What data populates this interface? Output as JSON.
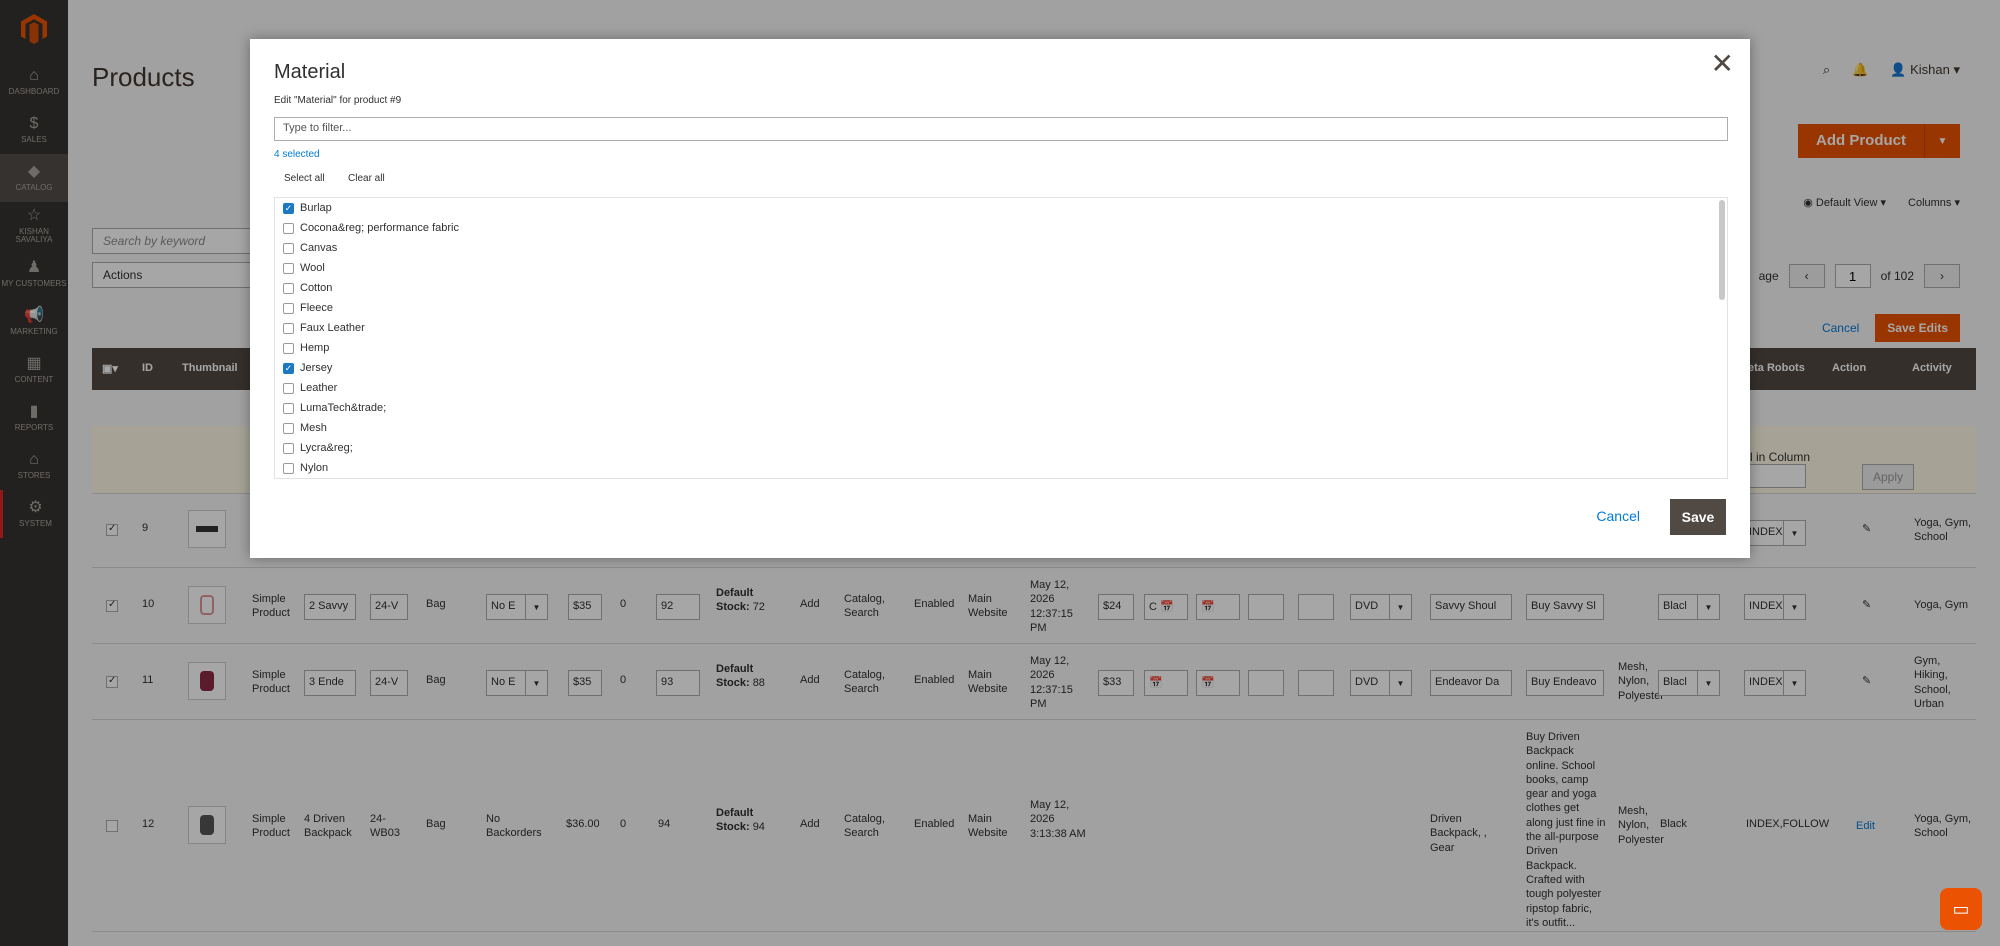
{
  "sidebar": {
    "items": [
      {
        "label": "DASHBOARD",
        "icon": "dashboard-icon",
        "glyph": "⌂"
      },
      {
        "label": "SALES",
        "icon": "dollar-icon",
        "glyph": "$"
      },
      {
        "label": "CATALOG",
        "icon": "cube-icon",
        "glyph": "◆"
      },
      {
        "label": "KISHAN SAVALIYA",
        "icon": "star-icon",
        "glyph": "☆"
      },
      {
        "label": "MY CUSTOMERS",
        "icon": "person-icon",
        "glyph": "♟"
      },
      {
        "label": "MARKETING",
        "icon": "megaphone-icon",
        "glyph": "📢"
      },
      {
        "label": "CONTENT",
        "icon": "content-icon",
        "glyph": "▦"
      },
      {
        "label": "REPORTS",
        "icon": "bar-chart-icon",
        "glyph": "▮"
      },
      {
        "label": "STORES",
        "icon": "store-icon",
        "glyph": "⌂"
      },
      {
        "label": "SYSTEM",
        "icon": "gear-icon",
        "glyph": "⚙"
      }
    ]
  },
  "page": {
    "title": "Products",
    "user": "Kishan",
    "add_product": "Add Product",
    "search_placeholder": "Search by keyword",
    "actions": "Actions",
    "default_view": "Default View",
    "columns": "Columns",
    "page_label": "age",
    "page_num": "1",
    "page_total": "of 102",
    "cancel": "Cancel",
    "save_edits": "Save Edits"
  },
  "grid": {
    "headers": {
      "id": "ID",
      "thumbnail": "Thumbnail",
      "meta_robots": "eta Robots",
      "action": "Action",
      "activity": "Activity"
    },
    "filter": {
      "in_column": "l in Column",
      "apply": "Apply"
    },
    "rows": [
      {
        "checked": true,
        "id": "9",
        "activity": "Yoga, Gym, School",
        "robots": "INDEX"
      },
      {
        "checked": true,
        "id": "10",
        "type": "Simple Product",
        "name": "2 Savvy",
        "sku": "24-V",
        "set": "Bag",
        "backorders": "No E",
        "price": "$35",
        "qty_zero": "0",
        "qty": "92",
        "stock_label": "Default Stock:",
        "stock": "72",
        "add": "Add",
        "visibility": "Catalog, Search",
        "status": "Enabled",
        "website": "Main Website",
        "date": "May 12, 2026 12:37:15 PM",
        "special": "$24",
        "c1": "C",
        "format": "DVD",
        "meta_title": "Savvy Shoul",
        "meta_desc": "Buy Savvy Sl",
        "color": "Blacl",
        "robots": "INDEX",
        "activity": "Yoga, Gym"
      },
      {
        "checked": true,
        "id": "11",
        "type": "Simple Product",
        "name": "3 Ende",
        "sku": "24-V",
        "set": "Bag",
        "backorders": "No E",
        "price": "$35",
        "qty_zero": "0",
        "qty": "93",
        "stock_label": "Default Stock:",
        "stock": "88",
        "add": "Add",
        "visibility": "Catalog, Search",
        "status": "Enabled",
        "website": "Main Website",
        "date": "May 12, 2026 12:37:15 PM",
        "special": "$33",
        "format": "DVD",
        "meta_title": "Endeavor Da",
        "meta_desc": "Buy Endeavo",
        "material": "Mesh, Nylon, Polyester",
        "color": "Blacl",
        "robots": "INDEX",
        "activity": "Gym, Hiking, School, Urban"
      },
      {
        "checked": false,
        "id": "12",
        "type": "Simple Product",
        "name": "4 Driven Backpack",
        "sku": "24-WB03",
        "set": "Bag",
        "backorders": "No Backorders",
        "price": "$36.00",
        "qty_zero": "0",
        "qty": "94",
        "stock_label": "Default Stock:",
        "stock": "94",
        "add": "Add",
        "visibility": "Catalog, Search",
        "status": "Enabled",
        "website": "Main Website",
        "date": "May 12, 2026 3:13:38 AM",
        "meta_title": "Driven Backpack, , Gear",
        "description": "Buy Driven Backpack online. School books, camp gear and yoga clothes get along just fine in the all-purpose Driven Backpack. Crafted with tough polyester ripstop fabric, it's outfit...",
        "material": "Mesh, Nylon, Polyester",
        "color": "Black",
        "robots": "INDEX,FOLLOW",
        "edit": "Edit",
        "activity": "Yoga, Gym, School"
      }
    ]
  },
  "modal": {
    "title": "Material",
    "subtitle": "Edit \"Material\" for product #9",
    "filter_placeholder": "Type to filter...",
    "selected_count": "4 selected",
    "select_all": "Select all",
    "clear_all": "Clear all",
    "options": [
      {
        "label": "Burlap",
        "checked": true
      },
      {
        "label": "Cocona&reg; performance fabric",
        "checked": false
      },
      {
        "label": "Canvas",
        "checked": false
      },
      {
        "label": "Wool",
        "checked": false
      },
      {
        "label": "Cotton",
        "checked": false
      },
      {
        "label": "Fleece",
        "checked": false
      },
      {
        "label": "Faux Leather",
        "checked": false
      },
      {
        "label": "Hemp",
        "checked": false
      },
      {
        "label": "Jersey",
        "checked": true
      },
      {
        "label": "Leather",
        "checked": false
      },
      {
        "label": "LumaTech&trade;",
        "checked": false
      },
      {
        "label": "Mesh",
        "checked": false
      },
      {
        "label": "Lycra&reg;",
        "checked": false
      },
      {
        "label": "Nylon",
        "checked": false
      }
    ],
    "cancel": "Cancel",
    "save": "Save"
  },
  "colors": {
    "accent": "#eb5202",
    "sidebar": "#373330",
    "header": "#514943",
    "link": "#007bdb"
  }
}
